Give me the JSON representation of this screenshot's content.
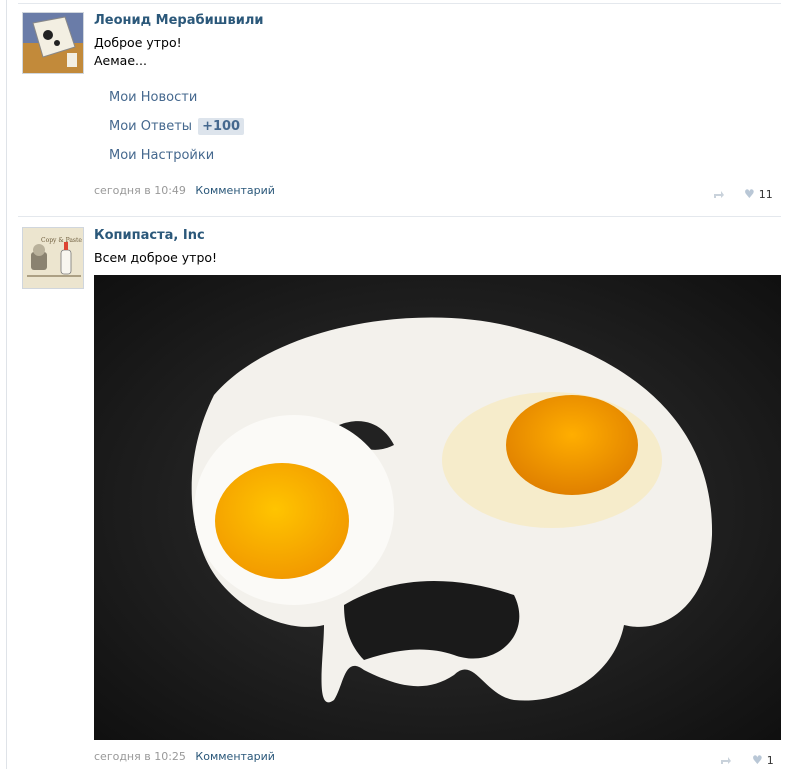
{
  "posts": [
    {
      "author": "Леонид Мерабишвили",
      "lines": [
        "Доброе утро!",
        "Аемае..."
      ],
      "menu": [
        {
          "label": "Мои Новости"
        },
        {
          "label": "Мои Ответы",
          "badge": "+100"
        },
        {
          "label": "Мои Настройки"
        }
      ],
      "time": "сегодня в 10:49",
      "comment_label": "Комментарий",
      "likes": "11"
    },
    {
      "author": "Копипаста, Inc",
      "text": "Всем доброе утро!",
      "avatar_caption": "Copy & Paste",
      "time": "сегодня в 10:25",
      "comment_label": "Комментарий",
      "likes": "1"
    }
  ],
  "icons": [
    "share-icon",
    "heart-icon"
  ]
}
